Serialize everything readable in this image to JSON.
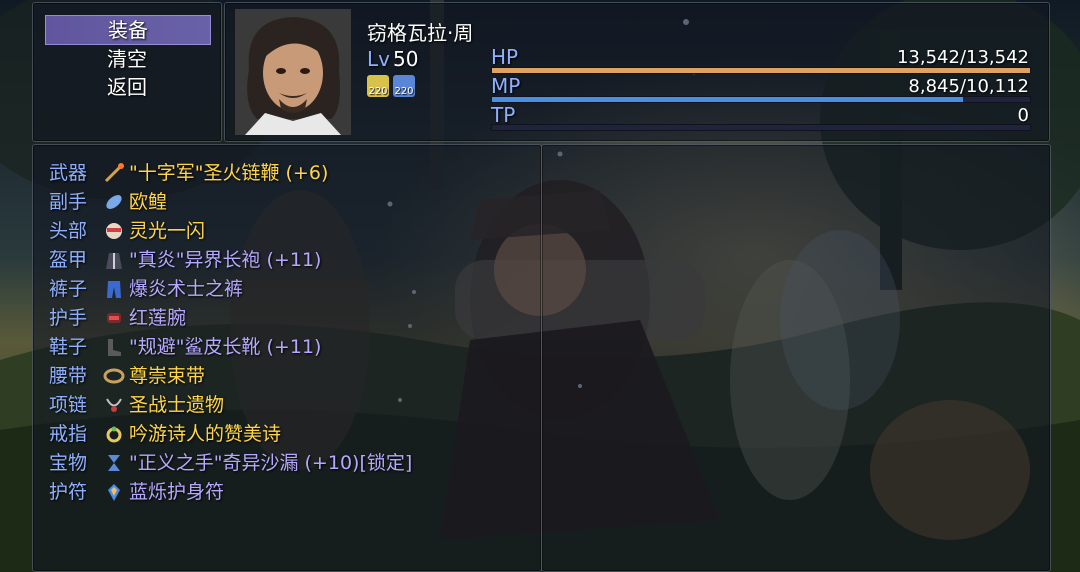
{
  "commands": [
    {
      "label": "装备",
      "selected": true
    },
    {
      "label": "清空",
      "selected": false
    },
    {
      "label": "返回",
      "selected": false
    }
  ],
  "actor": {
    "name": "窃格瓦拉·周",
    "level_label": "Lv",
    "level": "50",
    "states": [
      {
        "icon": "buff-attack-icon",
        "text": "220",
        "color": "#d9c24a"
      },
      {
        "icon": "buff-defense-icon",
        "text": "220",
        "color": "#5b86d6"
      }
    ],
    "hp": {
      "label": "HP",
      "text": "13,542/13,542",
      "ratio": 1.0,
      "color": "#e0a262"
    },
    "mp": {
      "label": "MP",
      "text": "8,845/10,112",
      "ratio": 0.875,
      "color": "#4a8fe0"
    },
    "tp": {
      "label": "TP",
      "text": "0",
      "ratio": 0.0,
      "color": "#3b9a52"
    }
  },
  "equipment": [
    {
      "slot": "武器",
      "icon": "whip-icon",
      "item": "\"十字军\"圣火链鞭 (+6)",
      "rarity": "gold"
    },
    {
      "slot": "副手",
      "icon": "fish-icon",
      "item": "欧鳇",
      "rarity": "gold"
    },
    {
      "slot": "头部",
      "icon": "mask-icon",
      "item": "灵光一闪",
      "rarity": "gold"
    },
    {
      "slot": "盔甲",
      "icon": "robe-icon",
      "item": "\"真炎\"异界长袍 (+11)",
      "rarity": "violet"
    },
    {
      "slot": "裤子",
      "icon": "pants-icon",
      "item": "爆炎术士之裤",
      "rarity": "violet"
    },
    {
      "slot": "护手",
      "icon": "bracer-icon",
      "item": "红莲腕",
      "rarity": "violet"
    },
    {
      "slot": "鞋子",
      "icon": "boots-icon",
      "item": "\"规避\"鲨皮长靴 (+11)",
      "rarity": "violet"
    },
    {
      "slot": "腰带",
      "icon": "belt-icon",
      "item": "尊崇束带",
      "rarity": "gold"
    },
    {
      "slot": "项链",
      "icon": "necklace-icon",
      "item": "圣战士遗物",
      "rarity": "gold"
    },
    {
      "slot": "戒指",
      "icon": "ring-icon",
      "item": "吟游诗人的赞美诗",
      "rarity": "gold"
    },
    {
      "slot": "宝物",
      "icon": "hourglass-icon",
      "item": "\"正义之手\"奇异沙漏 (+10)[锁定]",
      "rarity": "violet"
    },
    {
      "slot": "护符",
      "icon": "amulet-icon",
      "item": "蓝烁护身符",
      "rarity": "violet"
    }
  ]
}
